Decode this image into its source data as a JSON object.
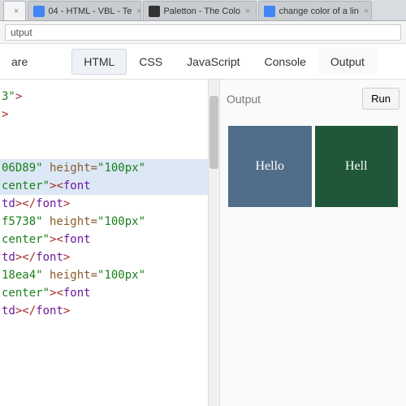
{
  "browser": {
    "tabs": [
      {
        "label": "",
        "close": "×"
      },
      {
        "label": "04 - HTML - VBL - Te",
        "close": "×"
      },
      {
        "label": "Paletton - The Colo",
        "close": "×"
      },
      {
        "label": "change color of a lin",
        "close": "×"
      }
    ],
    "url": "utput"
  },
  "toolbar": {
    "share_label": "are",
    "tabs": [
      "HTML",
      "CSS",
      "JavaScript",
      "Console",
      "Output"
    ],
    "active_tab": "HTML"
  },
  "code": {
    "l1a": "3\"",
    "l1b": ">",
    "l2": ">",
    "l3a": "06D89\"",
    "l3b": " height=",
    "l3c": "\"100px\"",
    "l4a": "center\"",
    "l4b": "><",
    "l4c": "font",
    "l5a": "td",
    "l5b": "></",
    "l5c": "font",
    "l5d": ">",
    "l6a": "f5738\"",
    "l6b": " height=",
    "l6c": "\"100px\"",
    "l7a": "center\"",
    "l7b": "><",
    "l7c": "font",
    "l8a": "td",
    "l8b": "></",
    "l8c": "font",
    "l8d": ">",
    "l9a": "18ea4\"",
    "l9b": " height=",
    "l9c": "\"100px\"",
    "l10a": "center\"",
    "l10b": "><",
    "l10c": "font",
    "l11a": "td",
    "l11b": "></",
    "l11c": "font",
    "l11d": ">"
  },
  "output": {
    "title": "Output",
    "run_label": "Run",
    "cells": [
      {
        "text": "Hello",
        "bg": "#506D89"
      },
      {
        "text": "Hell",
        "bg": "#1f5738"
      }
    ]
  }
}
